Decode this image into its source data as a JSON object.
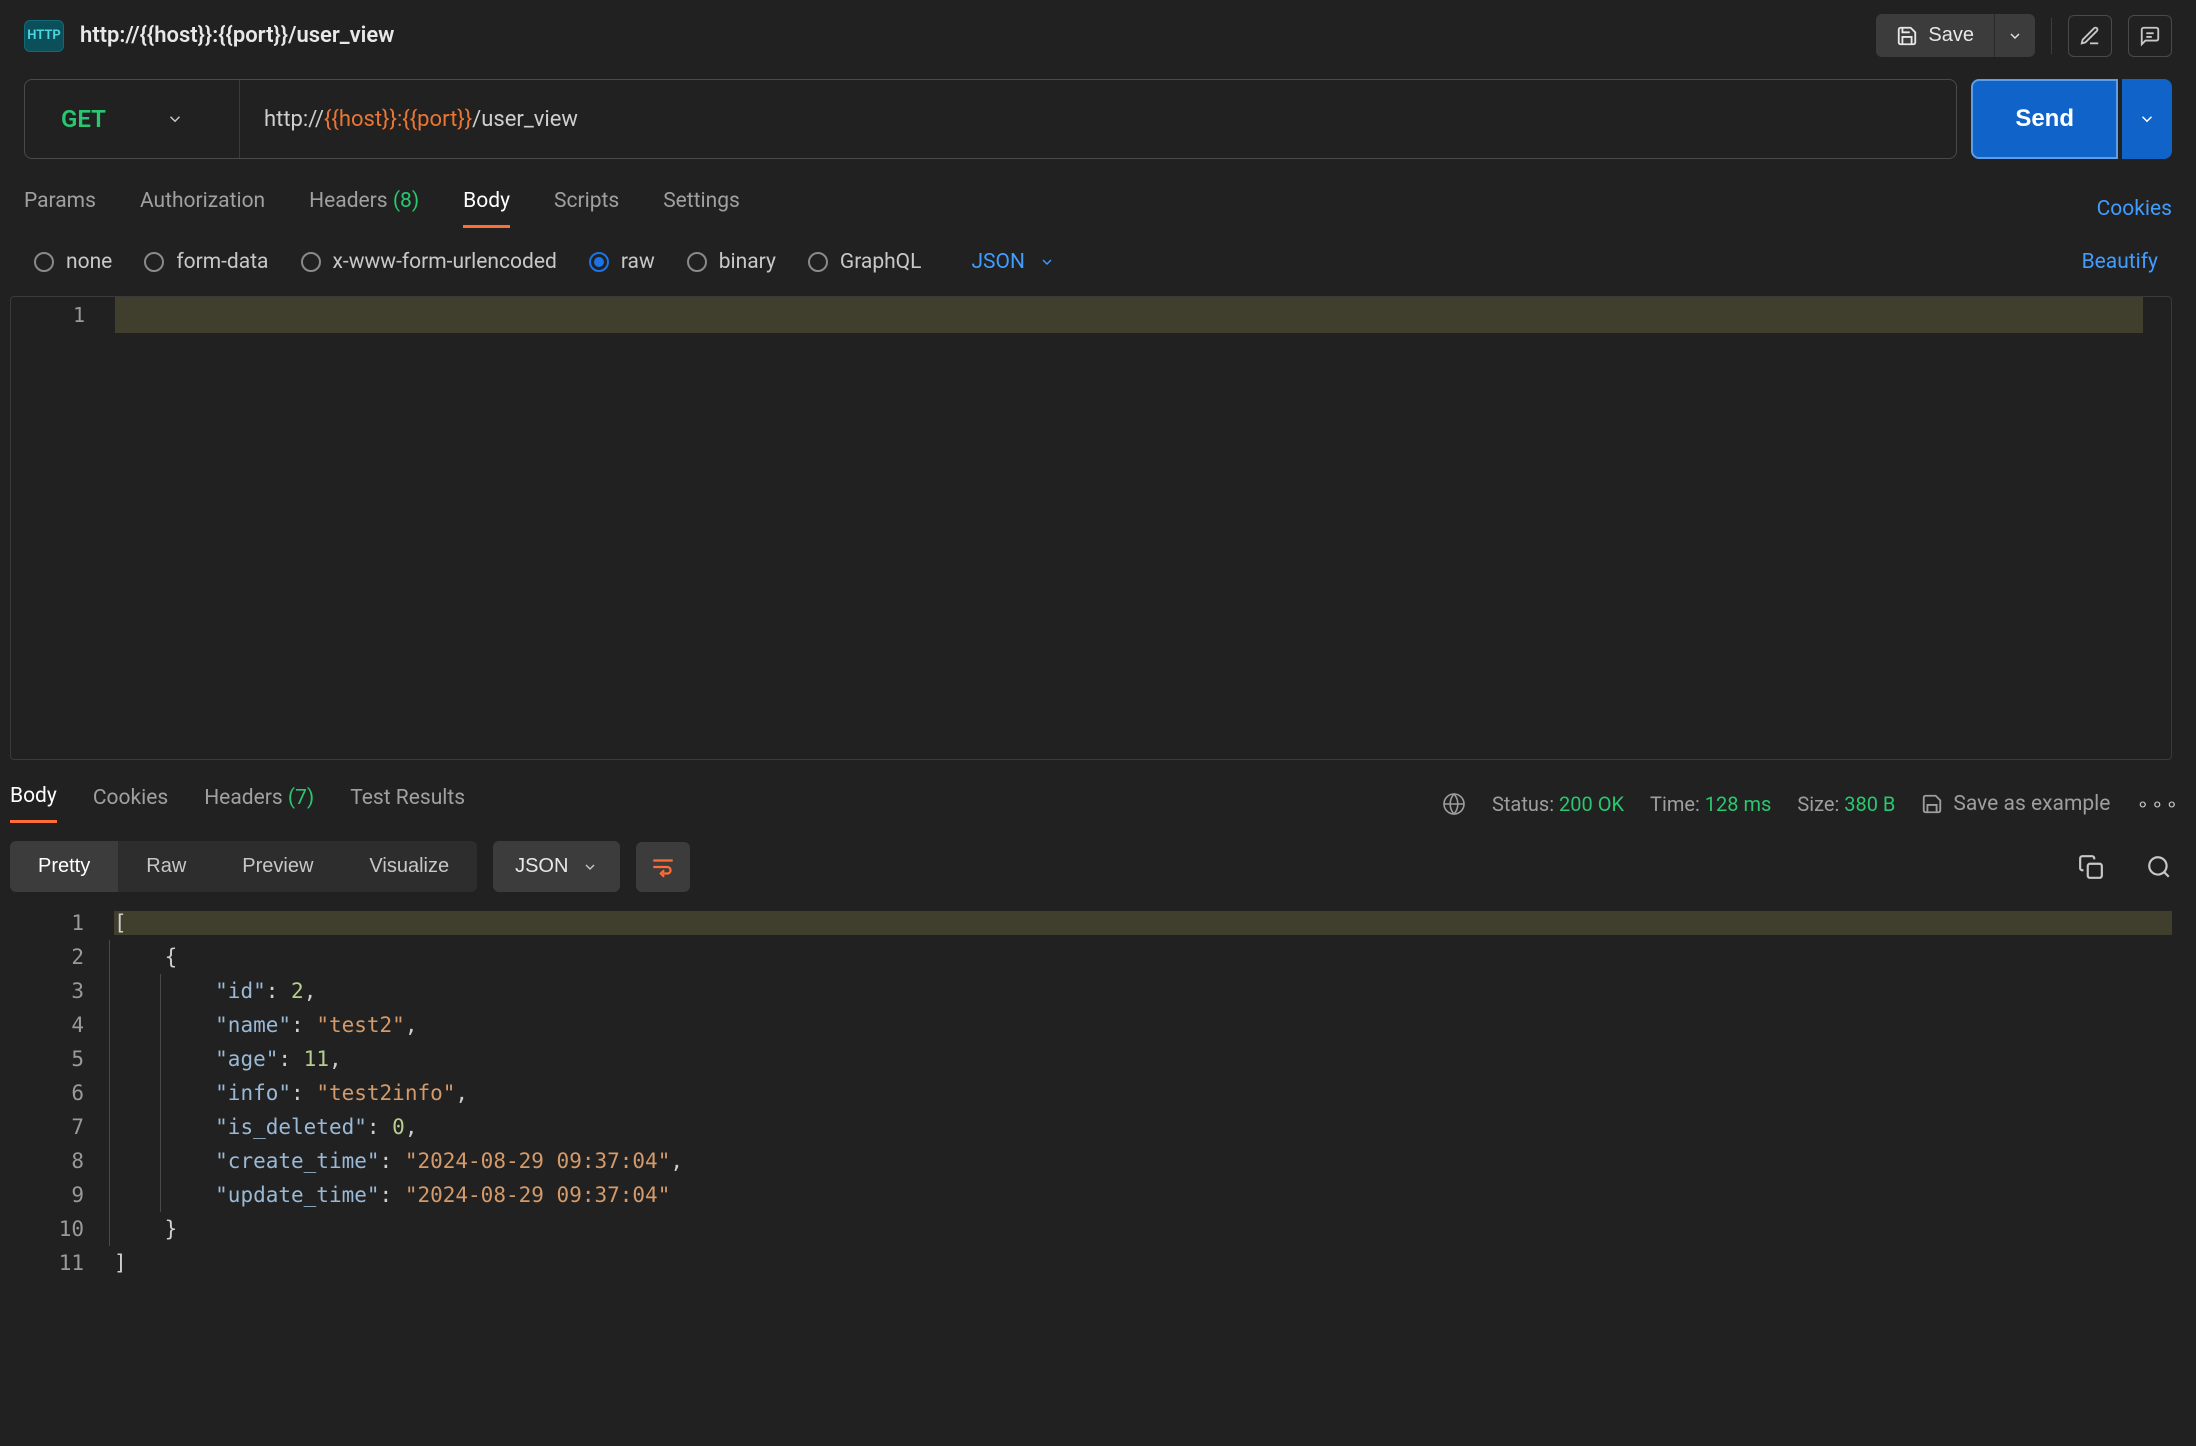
{
  "header": {
    "http_badge": "HTTP",
    "breadcrumb": "http://{{host}}:{{port}}/user_view",
    "save_label": "Save"
  },
  "request": {
    "method": "GET",
    "url_prefix": "http://",
    "url_host_tpl": "{{host}}",
    "url_colon": ":",
    "url_port_tpl": "{{port}}",
    "url_path": "/user_view",
    "send_label": "Send"
  },
  "req_tabs": {
    "params": "Params",
    "authorization": "Authorization",
    "headers_label": "Headers",
    "headers_count": "(8)",
    "body": "Body",
    "scripts": "Scripts",
    "settings": "Settings",
    "cookies": "Cookies"
  },
  "body_radios": {
    "none": "none",
    "form_data": "form-data",
    "xwww": "x-www-form-urlencoded",
    "raw": "raw",
    "binary": "binary",
    "graphql": "GraphQL",
    "format": "JSON",
    "beautify": "Beautify"
  },
  "req_editor": {
    "line1_num": "1"
  },
  "resp_tabs": {
    "body": "Body",
    "cookies": "Cookies",
    "headers_label": "Headers",
    "headers_count": "(7)",
    "test_results": "Test Results"
  },
  "resp_meta": {
    "status_label": "Status:",
    "status_value": "200 OK",
    "time_label": "Time:",
    "time_value": "128 ms",
    "size_label": "Size:",
    "size_value": "380 B",
    "save_example": "Save as example"
  },
  "resp_toolbar": {
    "pretty": "Pretty",
    "raw": "Raw",
    "preview": "Preview",
    "visualize": "Visualize",
    "format": "JSON"
  },
  "response_json": {
    "lines": [
      "1",
      "2",
      "3",
      "4",
      "5",
      "6",
      "7",
      "8",
      "9",
      "10",
      "11"
    ],
    "l1": "[",
    "l2_indent": "    ",
    "l2_brace": "{",
    "kv": [
      {
        "k": "\"id\"",
        "sep": ": ",
        "v": "2",
        "comma": ",",
        "vtype": "num"
      },
      {
        "k": "\"name\"",
        "sep": ": ",
        "v": "\"test2\"",
        "comma": ",",
        "vtype": "str"
      },
      {
        "k": "\"age\"",
        "sep": ": ",
        "v": "11",
        "comma": ",",
        "vtype": "num"
      },
      {
        "k": "\"info\"",
        "sep": ": ",
        "v": "\"test2info\"",
        "comma": ",",
        "vtype": "str"
      },
      {
        "k": "\"is_deleted\"",
        "sep": ": ",
        "v": "0",
        "comma": ",",
        "vtype": "num"
      },
      {
        "k": "\"create_time\"",
        "sep": ": ",
        "v": "\"2024-08-29 09:37:04\"",
        "comma": ",",
        "vtype": "str"
      },
      {
        "k": "\"update_time\"",
        "sep": ": ",
        "v": "\"2024-08-29 09:37:04\"",
        "comma": "",
        "vtype": "str"
      }
    ],
    "l10_indent": "    ",
    "l10_brace": "}",
    "l11": "]"
  }
}
